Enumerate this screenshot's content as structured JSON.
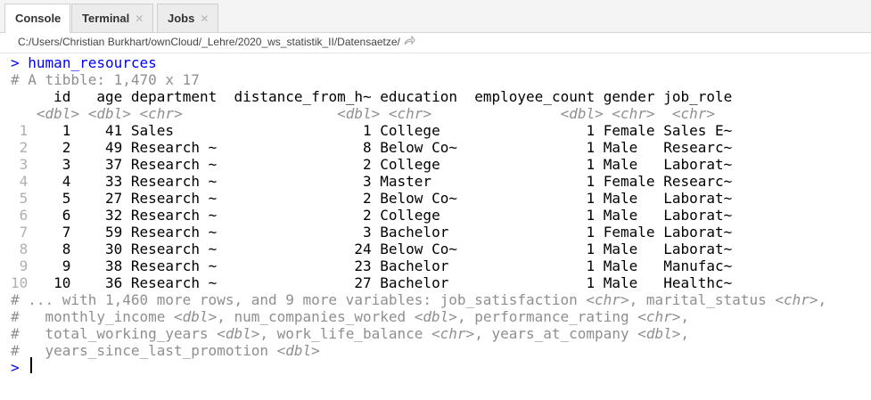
{
  "tabs": [
    {
      "label": "Console",
      "closable": false
    },
    {
      "label": "Terminal",
      "closable": true
    },
    {
      "label": "Jobs",
      "closable": true
    }
  ],
  "icons": {
    "tab_close": "close-icon",
    "goto_dir": "go-to-directory-icon"
  },
  "colors": {
    "command": "#0000ff",
    "comment": "#8f8f8f",
    "data": "#000000",
    "row_number": "#b0b0b0"
  },
  "working_dir": "C:/Users/Christian Burkhart/ownCloud/_Lehre/2020_ws_statistik_II/Datensaetze/",
  "console": {
    "prompt": ">",
    "command": "human_resources",
    "tibble_info": "# A tibble: 1,470 x 17",
    "table": {
      "columns": [
        "id",
        "age",
        "department",
        "distance_from_h~",
        "education",
        "employee_count",
        "gender",
        "job_role"
      ],
      "types": [
        "<dbl>",
        "<dbl>",
        "<chr>",
        "<dbl>",
        "<chr>",
        "<dbl>",
        "<chr>",
        "<chr>"
      ],
      "rows": [
        [
          "1",
          "1",
          "41",
          "Sales",
          "1",
          "College",
          "1",
          "Female",
          "Sales E~"
        ],
        [
          "2",
          "2",
          "49",
          "Research ~",
          "8",
          "Below Co~",
          "1",
          "Male",
          "Researc~"
        ],
        [
          "3",
          "3",
          "37",
          "Research ~",
          "2",
          "College",
          "1",
          "Male",
          "Laborat~"
        ],
        [
          "4",
          "4",
          "33",
          "Research ~",
          "3",
          "Master",
          "1",
          "Female",
          "Researc~"
        ],
        [
          "5",
          "5",
          "27",
          "Research ~",
          "2",
          "Below Co~",
          "1",
          "Male",
          "Laborat~"
        ],
        [
          "6",
          "6",
          "32",
          "Research ~",
          "2",
          "College",
          "1",
          "Male",
          "Laborat~"
        ],
        [
          "7",
          "7",
          "59",
          "Research ~",
          "3",
          "Bachelor",
          "1",
          "Female",
          "Laborat~"
        ],
        [
          "8",
          "8",
          "30",
          "Research ~",
          "24",
          "Below Co~",
          "1",
          "Male",
          "Laborat~"
        ],
        [
          "9",
          "9",
          "38",
          "Research ~",
          "23",
          "Bachelor",
          "1",
          "Male",
          "Manufac~"
        ],
        [
          "10",
          "10",
          "36",
          "Research ~",
          "27",
          "Bachelor",
          "1",
          "Male",
          "Healthc~"
        ]
      ]
    },
    "footer": [
      "# ... with 1,460 more rows, and 9 more variables: job_satisfaction <chr>, marital_status <chr>,",
      "#   monthly_income <dbl>, num_companies_worked <dbl>, performance_rating <chr>,",
      "#   total_working_years <dbl>, work_life_balance <chr>, years_at_company <dbl>,",
      "#   years_since_last_promotion <dbl>"
    ],
    "final_prompt": ">"
  }
}
